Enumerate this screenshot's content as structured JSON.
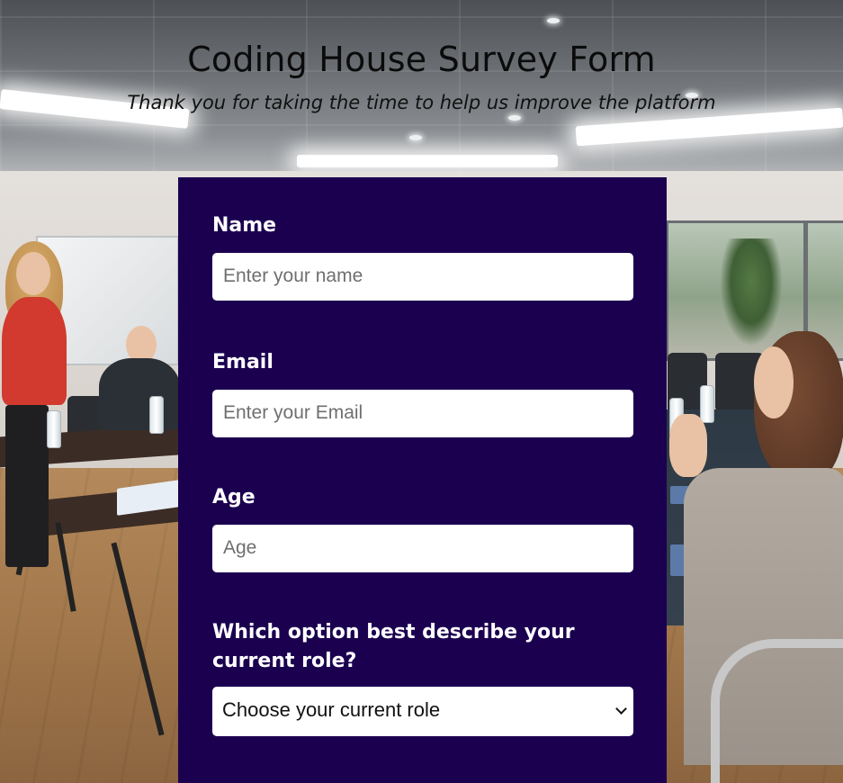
{
  "header": {
    "title": "Coding House Survey Form",
    "subtitle": "Thank you for taking the time to help us improve the platform"
  },
  "form": {
    "name": {
      "label": "Name",
      "placeholder": "Enter your name",
      "value": ""
    },
    "email": {
      "label": "Email",
      "placeholder": "Enter your Email",
      "value": ""
    },
    "age": {
      "label": "Age",
      "placeholder": "Age",
      "value": ""
    },
    "role": {
      "label": "Which option best describe your current role?",
      "selected": "Choose your current role",
      "icon": "chevron-down-icon"
    }
  },
  "colors": {
    "form_background": "#1b0050",
    "label_text": "#ffffff",
    "input_background": "#ffffff"
  }
}
